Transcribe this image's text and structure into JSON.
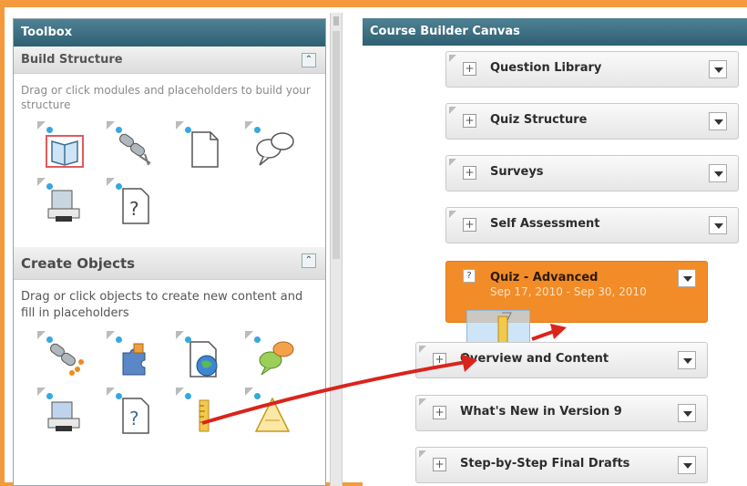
{
  "toolbox": {
    "title": "Toolbox",
    "build_structure": {
      "title": "Build Structure",
      "description": "Drag or click modules and placeholders to build your structure",
      "icons": [
        "book-module-icon",
        "link-placeholder-icon",
        "blank-page-icon",
        "discussion-icon",
        "print-dropbox-icon",
        "question-page-icon"
      ]
    },
    "create_objects": {
      "title": "Create Objects",
      "description": "Drag or click objects to create new content and fill in placeholders",
      "icons": [
        "link-object-icon",
        "puzzle-icon",
        "web-page-icon",
        "chat-icon",
        "dropbox-icon",
        "quiz-icon",
        "ruler-icon",
        "survey-icon"
      ]
    }
  },
  "canvas": {
    "title": "Course Builder Canvas",
    "modules": [
      {
        "label": "Question Library"
      },
      {
        "label": "Quiz Structure"
      },
      {
        "label": "Surveys"
      },
      {
        "label": "Self Assessment"
      },
      {
        "label": "Quiz - Advanced",
        "dates": "Sep 17, 2010 - Sep 30, 2010",
        "active": true
      },
      {
        "label": "Overview and Content"
      },
      {
        "label": "What's New in Version 9"
      },
      {
        "label": "Step-by-Step Final Drafts"
      }
    ]
  },
  "colors": {
    "header": "#2f5f72",
    "frame": "#f49a3c",
    "active_module": "#f28c28",
    "arrow": "#d9241c"
  }
}
